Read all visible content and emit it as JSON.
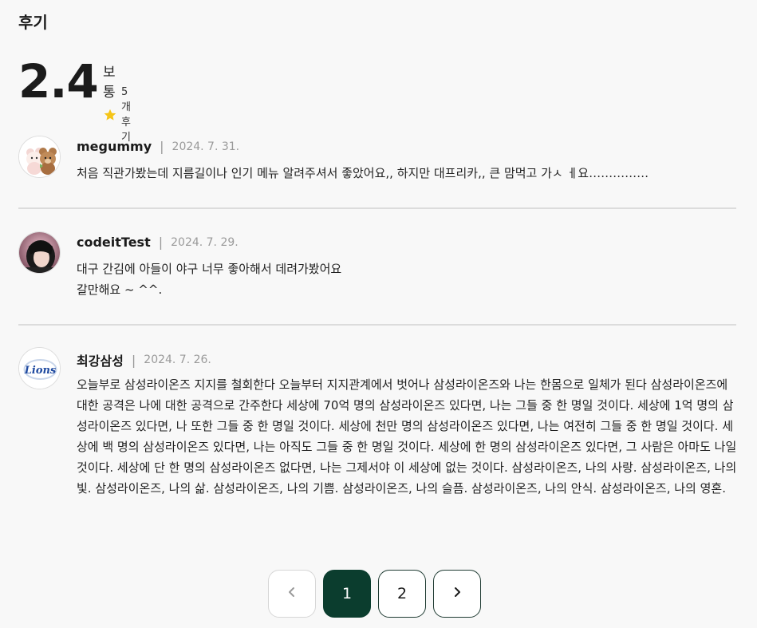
{
  "section": {
    "title": "후기"
  },
  "summary": {
    "score": "2.4",
    "grade": "보통",
    "count_label": "5개 후기",
    "star_color": "#f5c518"
  },
  "reviews": [
    {
      "avatar": "avatar-plush-bears",
      "name": "megummy",
      "separator": "|",
      "date": "2024. 7. 31.",
      "body": "처음 직관가봤는데 지름길이나 인기 메뉴 알려주셔서 좋았어요,, 하지만 대프리카,, 큰 맘먹고 가ㅅ ㅔ요……………"
    },
    {
      "avatar": "avatar-person-photo",
      "name": "codeitTest",
      "separator": "|",
      "date": "2024. 7. 29.",
      "body": "대구 간김에 아들이 야구 너무 좋아해서 데려가봤어요\n갈만해요 ~ ^^."
    },
    {
      "avatar": "avatar-lions-logo",
      "name": "최강삼성",
      "separator": "|",
      "date": "2024. 7. 26.",
      "logo_text": "Lions",
      "body": "오늘부로 삼성라이온즈 지지를 철회한다 오늘부터 지지관계에서 벗어나 삼성라이온즈와 나는 한몸으로 일체가 된다 삼성라이온즈에 대한 공격은 나에 대한 공격으로 간주한다 세상에 70억 명의 삼성라이온즈 있다면, 나는 그들 중 한 명일 것이다. 세상에 1억 명의 삼성라이온즈 있다면, 나 또한 그들 중 한 명일 것이다. 세상에 천만 명의 삼성라이온즈 있다면, 나는 여전히 그들 중 한 명일 것이다. 세상에 백 명의 삼성라이온즈 있다면, 나는 아직도 그들 중 한 명일 것이다. 세상에 한 명의 삼성라이온즈 있다면, 그 사람은 아마도 나일 것이다. 세상에 단 한 명의 삼성라이온즈 없다면, 나는 그제서야 이 세상에 없는 것이다. 삼성라이온즈, 나의 사랑. 삼성라이온즈, 나의 빛. 삼성라이온즈, 나의 삶. 삼성라이온즈, 나의 기쁨. 삼성라이온즈, 나의 슬픔. 삼성라이온즈, 나의 안식. 삼성라이온즈, 나의 영혼."
    }
  ],
  "pagination": {
    "prev_icon": "chevron-left-icon",
    "next_icon": "chevron-right-icon",
    "pages": [
      "1",
      "2"
    ],
    "current": "1",
    "active_color": "#0b3d2e"
  }
}
